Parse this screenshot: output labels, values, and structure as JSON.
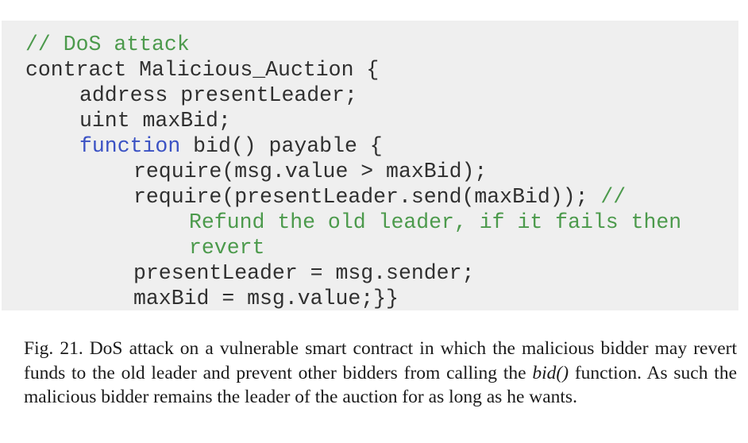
{
  "code": {
    "line1": "// DoS attack",
    "line2": "contract Malicious_Auction {",
    "line3": "address presentLeader;",
    "line4": "uint maxBid;",
    "line5_keyword": "function",
    "line5_rest": " bid() payable {",
    "line6": "require(msg.value > maxBid);",
    "line7_code": "require(presentLeader.send(maxBid));",
    "line7_comment": " //",
    "line8": "Refund the old leader, if it fails then",
    "line9": "revert",
    "line10": "presentLeader = msg.sender;",
    "line11": "maxBid = msg.value;}}"
  },
  "caption": {
    "label": "Fig. 21.",
    "text_before": "DoS attack on a vulnerable smart contract in which the malicious bidder may revert funds to the old leader and prevent other bidders from calling the ",
    "italic": "bid()",
    "text_after": " function. As such the malicious bidder remains the leader of the auction for as long as he wants."
  }
}
